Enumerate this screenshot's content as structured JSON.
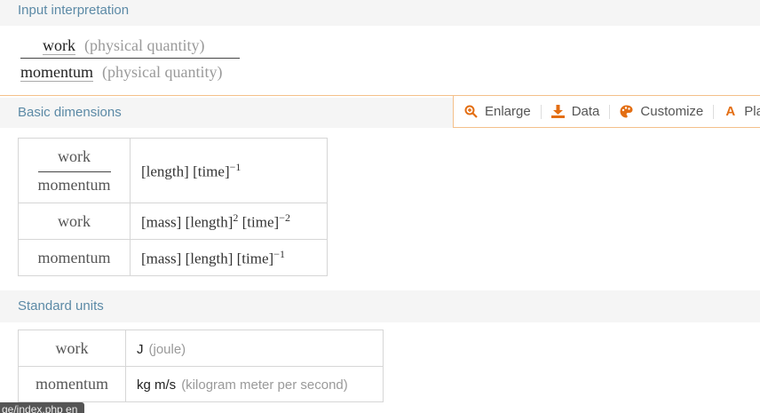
{
  "input_interpretation": {
    "header": "Input interpretation",
    "numerator": "work",
    "numerator_qualifier": "(physical quantity)",
    "denominator": "momentum",
    "denominator_qualifier": "(physical quantity)"
  },
  "basic_dimensions": {
    "header": "Basic dimensions",
    "rows": [
      {
        "label_num": "work",
        "label_den": "momentum",
        "value": "[length] [time]",
        "exp": "−1"
      },
      {
        "label": "work",
        "value_a": "[mass] [length]",
        "exp_a": "2",
        "value_b": " [time]",
        "exp_b": "−2"
      },
      {
        "label": "momentum",
        "value": "[mass] [length] [time]",
        "exp": "−1"
      }
    ]
  },
  "toolbar": {
    "enlarge": "Enlarge",
    "data": "Data",
    "customize": "Customize",
    "plain": "Plai"
  },
  "standard_units": {
    "header": "Standard units",
    "rows": [
      {
        "label": "work",
        "unit": "J",
        "desc": "(joule)"
      },
      {
        "label": "momentum",
        "unit": "kg m/s",
        "desc": "(kilogram meter per second)"
      }
    ]
  },
  "status_bar": {
    "url_fragment": "ge/index.php en"
  },
  "colors": {
    "header_text": "#5c8aa6",
    "accent": "#e36e13",
    "border_accent": "#f4c08a"
  }
}
